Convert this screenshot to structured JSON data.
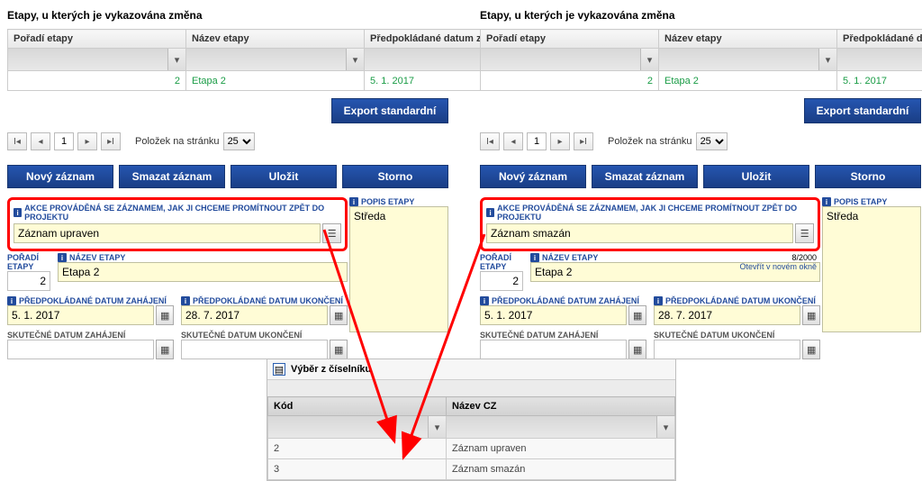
{
  "section_title": "Etapy, u kterých je vykazována změna",
  "table": {
    "cols": {
      "order": "Pořadí etapy",
      "name": "Název etapy",
      "date": "Předpokládané datum zahájení"
    },
    "row": {
      "order": "2",
      "name": "Etapa 2",
      "date": "5. 1. 2017"
    }
  },
  "export_btn": "Export standardní",
  "pager": {
    "page": "1",
    "perpage_label": "Položek na stránku",
    "perpage": "25"
  },
  "actions": {
    "new": "Nový záznam",
    "delete": "Smazat záznam",
    "save": "Uložit",
    "cancel": "Storno"
  },
  "form": {
    "akce_label": "AKCE PROVÁDĚNÁ SE ZÁZNAMEM, JAK JI CHCEME PROMÍTNOUT ZPĚT DO PROJEKTU",
    "akce_left": "Záznam upraven",
    "akce_right": "Záznam smazán",
    "poradi_label": "POŘADÍ ETAPY",
    "poradi_value": "2",
    "nazev_label": "NÁZEV ETAPY",
    "nazev_value": "Etapa 2",
    "charcount": "8/2000",
    "newwin": "Otevřít v novém okně",
    "d1_label": "PŘEDPOKLÁDANÉ DATUM ZAHÁJENÍ",
    "d1_value": "5. 1. 2017",
    "d2_label": "PŘEDPOKLÁDANÉ DATUM UKONČENÍ",
    "d2_value": "28. 7. 2017",
    "d3_label": "SKUTEČNÉ DATUM ZAHÁJENÍ",
    "d4_label": "SKUTEČNÉ DATUM UKONČENÍ",
    "popis_label": "POPIS ETAPY",
    "popis_value": "Středa"
  },
  "popup": {
    "title": "Výběr z číselníku",
    "cols": {
      "code": "Kód",
      "name": "Název CZ"
    },
    "rows": [
      {
        "code": "2",
        "name": "Záznam upraven"
      },
      {
        "code": "3",
        "name": "Záznam smazán"
      }
    ]
  }
}
